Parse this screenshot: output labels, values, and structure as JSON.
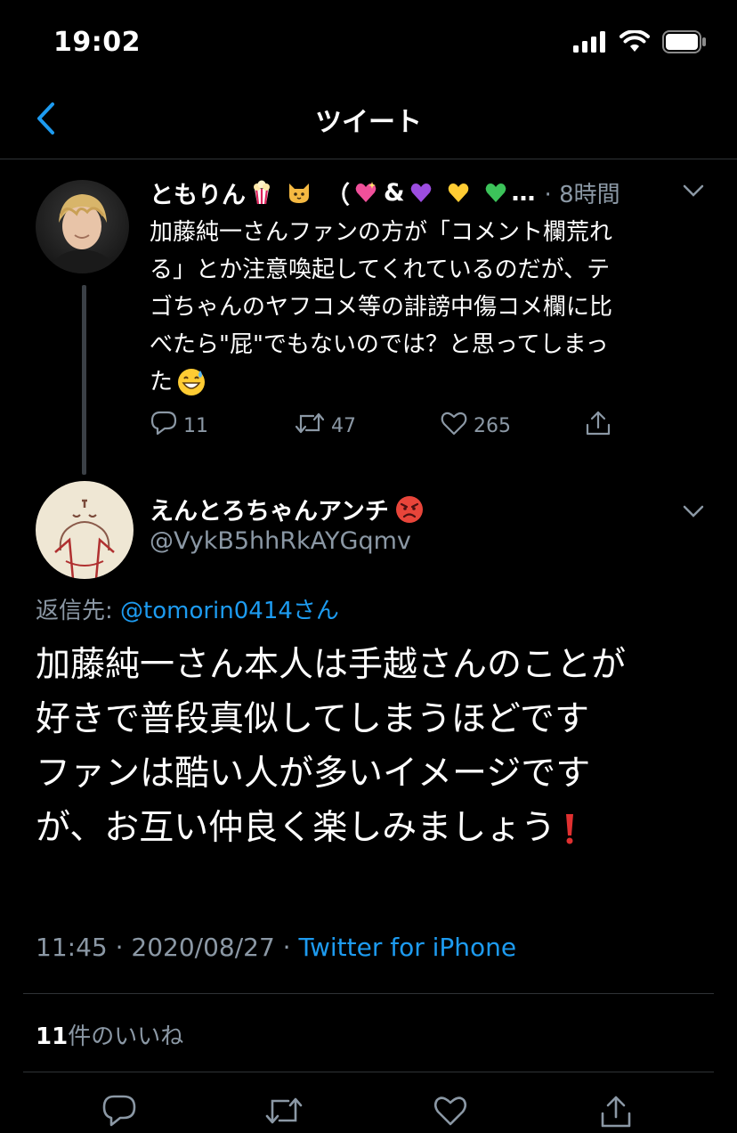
{
  "status_bar": {
    "time": "19:02"
  },
  "nav": {
    "title": "ツイート",
    "back_icon": "chevron-left-icon"
  },
  "parent_tweet": {
    "display_name": "ともりん",
    "name_suffix": "（",
    "name_emojis": [
      "popcorn",
      "cat-face",
      "sparkling-heart",
      "&",
      "purple-heart",
      "yellow-heart",
      "green-heart"
    ],
    "ampersand": "&",
    "ellipsis": "…",
    "time_ago": "· 8時間",
    "body_lines": [
      "加藤純一さんファンの方が「コメント欄荒れ",
      "る」とか注意喚起してくれているのだが、テ",
      "ゴちゃんのヤフコメ等の誹謗中傷コメ欄に比",
      "べたら\"屁\"でもないのでは？と思ってしまっ",
      "た"
    ],
    "replies": "11",
    "retweets": "47",
    "likes": "265"
  },
  "main_tweet": {
    "display_name": "えんとろちゃんアンチ",
    "handle": "@VykB5hhRkAYGqmv",
    "reply_prefix": "返信先: ",
    "reply_target": "@tomorin0414さん",
    "body_lines": [
      "加藤純一さん本人は手越さんのことが",
      "好きで普段真似してしまうほどです",
      "ファンは酷い人が多いイメージです",
      "が、お互い仲良く楽しみましょう"
    ],
    "timestamp": "11:45 · 2020/08/27 · ",
    "client": "Twitter for iPhone",
    "likes_count": "11",
    "likes_label": "件のいいね"
  },
  "colors": {
    "background": "#000000",
    "text": "#ffffff",
    "muted": "#8b98a5",
    "accent": "#1d9bf0",
    "divider": "#2f3336"
  }
}
